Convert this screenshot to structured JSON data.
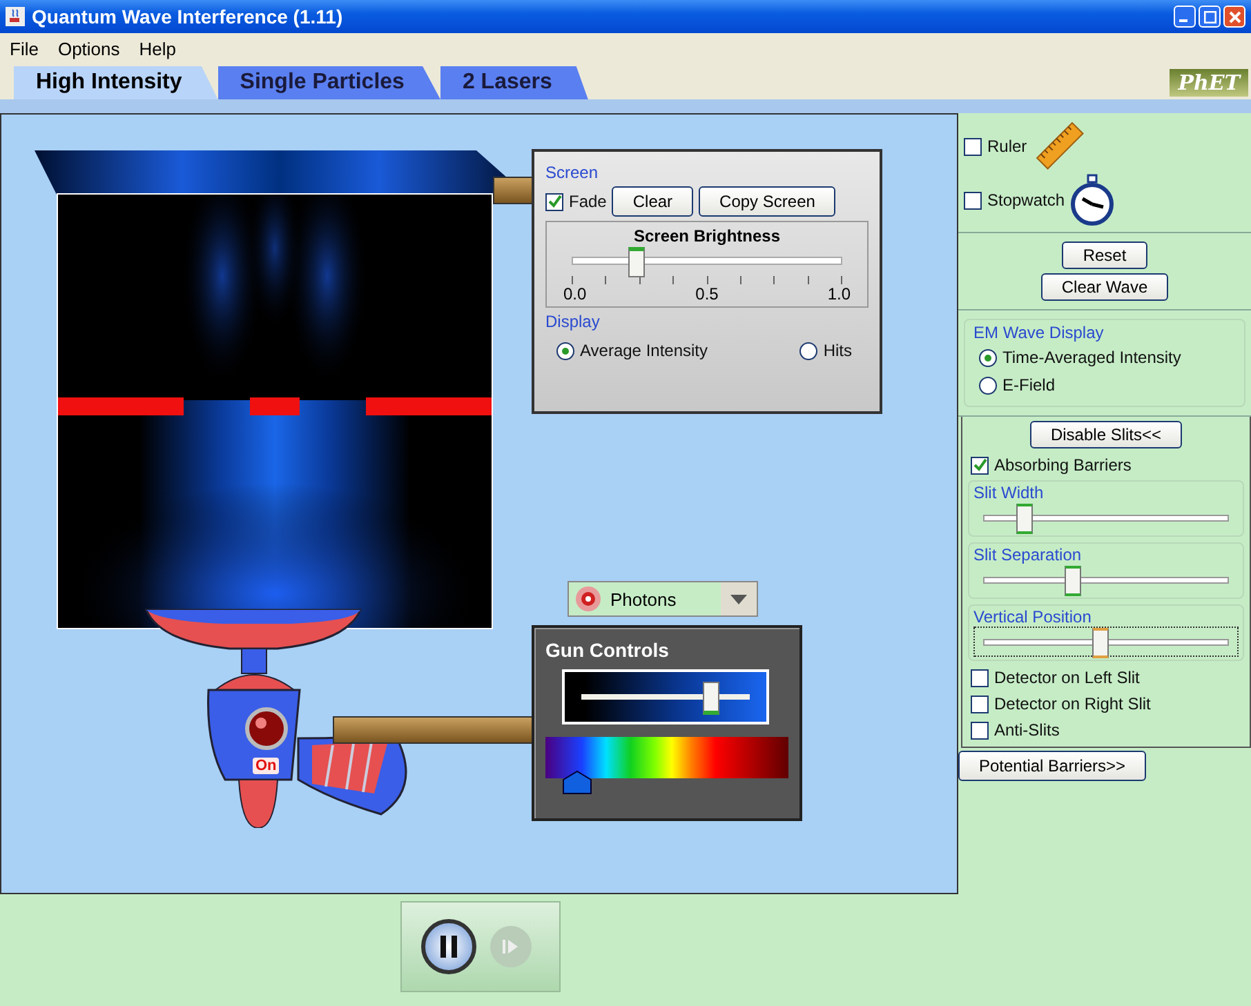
{
  "window": {
    "title": "Quantum Wave Interference (1.11)"
  },
  "menu": [
    "File",
    "Options",
    "Help"
  ],
  "tabs": [
    {
      "label": "High Intensity",
      "selected": true
    },
    {
      "label": "Single Particles",
      "selected": false
    },
    {
      "label": "2 Lasers",
      "selected": false
    }
  ],
  "logo": "PhET",
  "screen_panel": {
    "title": "Screen",
    "fade": {
      "label": "Fade",
      "checked": true
    },
    "buttons": [
      "Clear",
      "Copy Screen"
    ],
    "brightness": {
      "label": "Screen Brightness",
      "level": 0.23,
      "ticks": [
        "0.0",
        "0.5",
        "1.0"
      ]
    },
    "display": {
      "title": "Display",
      "options": [
        {
          "label": "Average Intensity",
          "selected": true
        },
        {
          "label": "Hits",
          "selected": false
        }
      ]
    }
  },
  "gun": {
    "power_label": "On",
    "particle": "Photons",
    "controls": {
      "title": "Gun Controls",
      "intensity": {
        "level": 0.76
      },
      "wavelength": {
        "level": 0.07
      }
    }
  },
  "right_panel": {
    "tools": [
      {
        "kind": "ruler",
        "label": "Ruler",
        "checked": false
      },
      {
        "kind": "stopwatch",
        "label": "Stopwatch",
        "checked": false
      }
    ],
    "buttons": [
      "Reset",
      "Clear Wave"
    ],
    "em_wave_display": {
      "title": "EM Wave Display",
      "options": [
        {
          "label": "Time-Averaged Intensity",
          "selected": true
        },
        {
          "label": "E-Field",
          "selected": false
        }
      ]
    },
    "slits": {
      "button": "Disable Slits<<",
      "absorbing_barriers": {
        "label": "Absorbing Barriers",
        "checked": true
      },
      "sliders": [
        {
          "label": "Slit Width",
          "level": 0.16,
          "focused": false
        },
        {
          "label": "Slit Separation",
          "level": 0.36,
          "focused": false
        },
        {
          "label": "Vertical Position",
          "level": 0.47,
          "focused": true
        }
      ],
      "checkboxes": [
        {
          "label": "Detector on Left Slit",
          "checked": false
        },
        {
          "label": "Detector on Right Slit",
          "checked": false
        },
        {
          "label": "Anti-Slits",
          "checked": false
        }
      ]
    },
    "potential_button": "Potential Barriers>>"
  }
}
